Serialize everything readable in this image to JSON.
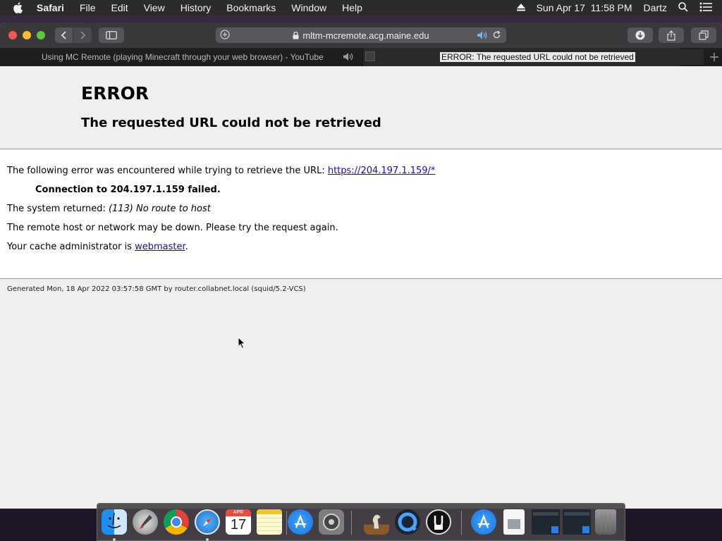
{
  "menubar": {
    "app_name": "Safari",
    "items": [
      "File",
      "Edit",
      "View",
      "History",
      "Bookmarks",
      "Window",
      "Help"
    ],
    "datetime": "Sun Apr 17  11:58 PM",
    "user": "Dartz"
  },
  "toolbar": {
    "address": "mltm-mcremote.acg.maine.edu"
  },
  "tabs": [
    {
      "title": "Using MC Remote (playing Minecraft through your web browser) - YouTube"
    },
    {
      "title": "ERROR: The requested URL could not be retrieved"
    }
  ],
  "page": {
    "title": "ERROR",
    "subtitle": "The requested URL could not be retrieved",
    "line1_prefix": "The following error was encountered while trying to retrieve the URL: ",
    "line1_link": "https://204.197.1.159/*",
    "line2": "Connection to 204.197.1.159 failed.",
    "line3_prefix": "The system returned: ",
    "line3_detail": "(113) No route to host",
    "line4": "The remote host or network may be down. Please try the request again.",
    "line5_prefix": "Your cache administrator is ",
    "line5_link": "webmaster",
    "line5_suffix": ".",
    "footer": "Generated Mon, 18 Apr 2022 03:57:58 GMT by router.collabnet.local (squid/5.2-VCS)"
  },
  "dock": {
    "calendar_month": "APR",
    "calendar_day": "17",
    "apps": [
      "finder",
      "launchpad",
      "chrome",
      "safari",
      "calendar",
      "notes",
      "app-store",
      "system-preferences",
      "chess",
      "quicktime",
      "unblock",
      "app-store-2",
      "preview",
      "window-1",
      "window-2",
      "trash"
    ]
  }
}
